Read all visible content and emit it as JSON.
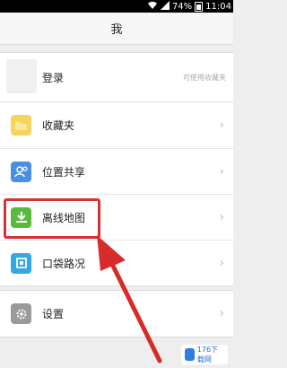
{
  "status_bar": {
    "battery_percent": "74%",
    "time": "11:04"
  },
  "header": {
    "title": "我"
  },
  "login": {
    "label": "登录",
    "hint": "可使用收藏夹"
  },
  "menu": [
    {
      "label": "收藏夹",
      "icon": "folder-icon",
      "color": "#f3d65b"
    },
    {
      "label": "位置共享",
      "icon": "location-share-icon",
      "color": "#4a8fe3"
    },
    {
      "label": "离线地图",
      "icon": "download-icon",
      "color": "#5aba3f"
    },
    {
      "label": "口袋路况",
      "icon": "traffic-icon",
      "color": "#35a7e6"
    }
  ],
  "settings": {
    "label": "设置",
    "icon": "gear-icon",
    "color": "#9a9a9a"
  },
  "watermark": {
    "text": "176下载网"
  }
}
